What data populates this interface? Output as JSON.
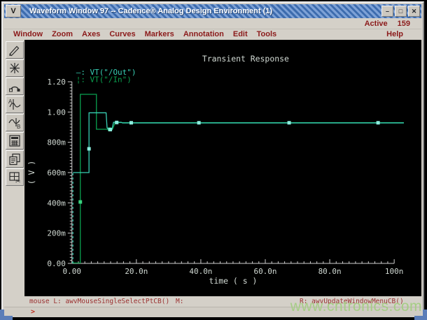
{
  "window": {
    "title": "Waveform Window 97 -- Cadence® Analog Design Environment (1)",
    "menu_button_glyph": "V",
    "controls": {
      "minimize": "–",
      "maximize": "□",
      "close": "✕"
    },
    "active_label": "Active",
    "active_value": "159",
    "help_label": "Help"
  },
  "menu": {
    "items": [
      "Window",
      "Zoom",
      "Axes",
      "Curves",
      "Markers",
      "Annotation",
      "Edit",
      "Tools"
    ]
  },
  "toolbar": {
    "icons": [
      "pen-icon",
      "zoom-star-icon",
      "arc-probe-icon",
      "marker-a-icon",
      "marker-b-icon",
      "calculator-icon",
      "copy-window-icon",
      "split-cut-icon"
    ]
  },
  "statusbar": {
    "mouse_left": "mouse L: awvMouseSingleSelectPtCB()",
    "mouse_middle": "M:",
    "mouse_right": "R: awvUpdateWindowMenuCB()",
    "prompt": ">"
  },
  "watermark": "www.cntronics.com",
  "colors": {
    "plot_bg": "#000000",
    "axis": "#cfcfcf",
    "plot_text": "#d2dad4",
    "menu_text": "#8b1a1a",
    "titlebar_blue": "#3d6cae",
    "corner_blue": "#5b7db8"
  },
  "chart_data": {
    "type": "line",
    "title": "Transient Response",
    "xlabel": "time ( s )",
    "ylabel": "( V )",
    "x_unit": "ns",
    "xlim": [
      0,
      100
    ],
    "ylim": [
      0,
      1.2
    ],
    "x_tick_values": [
      0,
      20,
      40,
      60,
      80,
      100
    ],
    "x_tick_labels": [
      "0.00",
      "20.0n",
      "40.0n",
      "60.0n",
      "80.0n",
      "100n"
    ],
    "x_minor_step": 2,
    "y_tick_values": [
      0,
      0.2,
      0.4,
      0.6,
      0.8,
      1.0,
      1.2
    ],
    "y_tick_labels": [
      "0.00",
      "200m",
      "400m",
      "600m",
      "800m",
      "1.00",
      "1.20"
    ],
    "y_minor_step": 0.02,
    "grid": false,
    "legend_position": "top-left-inside",
    "series": [
      {
        "name": "VT(\"/Out\")",
        "legend_marker": "–",
        "color": "#38cfb4",
        "marker_color": "#8ceede",
        "dashed_prefix": [
          [
            0.3,
            0.0
          ],
          [
            0.3,
            0.6
          ]
        ],
        "points": [
          [
            0.3,
            0.6
          ],
          [
            5.3,
            0.6
          ],
          [
            5.3,
            0.995
          ],
          [
            10.6,
            0.995
          ],
          [
            10.9,
            0.897
          ],
          [
            11.4,
            0.883
          ],
          [
            12.4,
            0.883
          ],
          [
            12.9,
            0.932
          ],
          [
            15.3,
            0.932
          ],
          [
            15.7,
            0.928
          ],
          [
            103,
            0.928
          ]
        ],
        "markers": [
          [
            5.3,
            0.757
          ],
          [
            11.9,
            0.884
          ],
          [
            13.9,
            0.931
          ],
          [
            18.4,
            0.929
          ],
          [
            39.4,
            0.929
          ],
          [
            67.4,
            0.929
          ],
          [
            95,
            0.929
          ]
        ]
      },
      {
        "name": "VT(\"/In\")",
        "legend_marker": "¦",
        "color": "#0aa04f",
        "marker_color": "#3ad37f",
        "points": [
          [
            0,
            0.003
          ],
          [
            2.6,
            0.003
          ],
          [
            2.6,
            1.117
          ],
          [
            7.6,
            1.117
          ],
          [
            7.6,
            0.886
          ],
          [
            12.6,
            0.886
          ],
          [
            13.4,
            0.93
          ],
          [
            103,
            0.93
          ]
        ],
        "markers": [
          [
            2.6,
            0.406
          ],
          [
            11.7,
            0.886
          ]
        ]
      }
    ]
  }
}
